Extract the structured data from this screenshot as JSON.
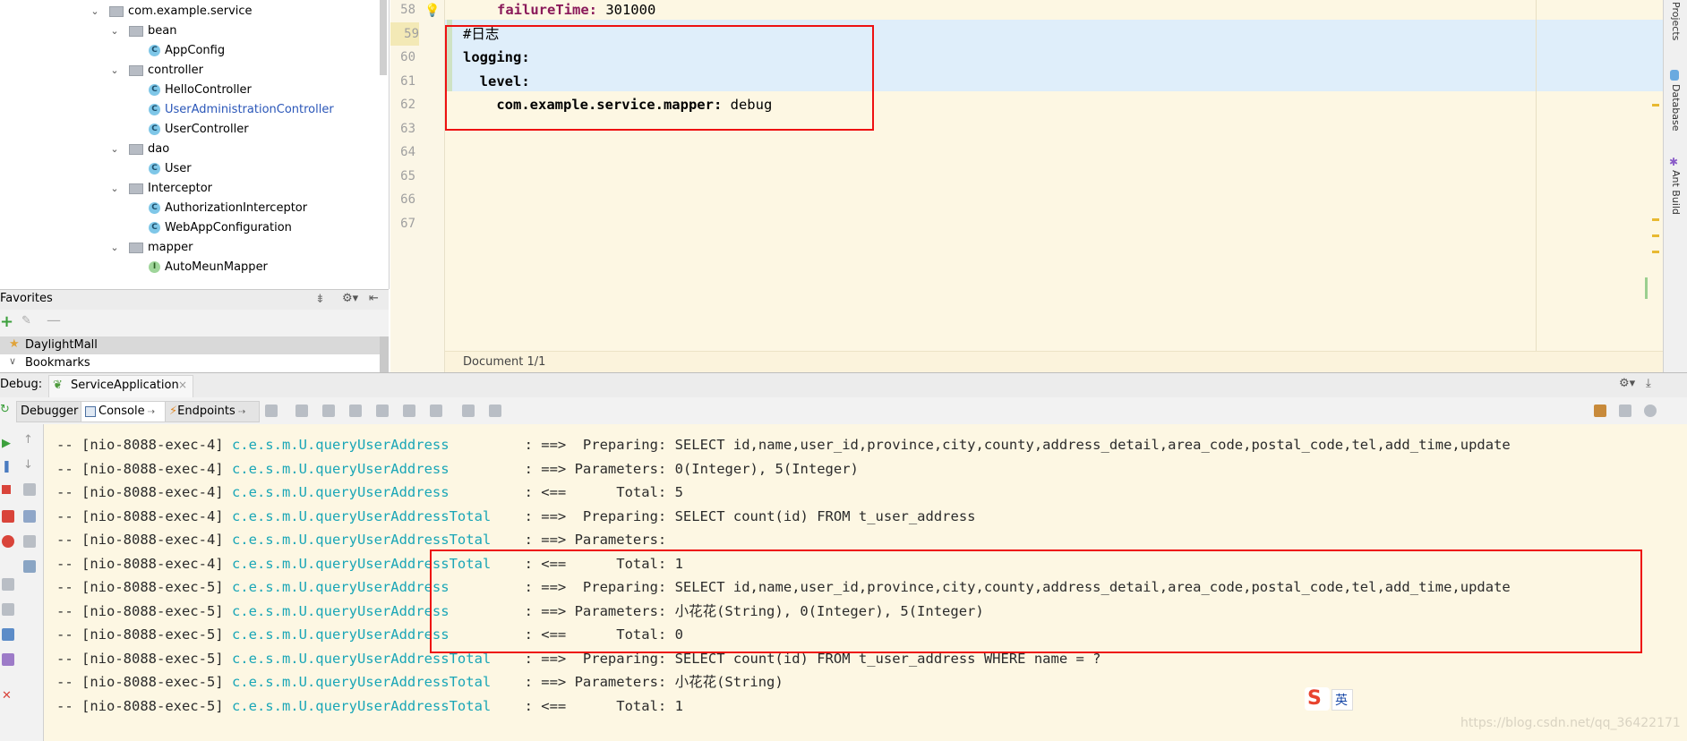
{
  "project_tree": {
    "items": [
      {
        "label": "com.example.service",
        "kind": "package",
        "expanded": true,
        "depth": 0
      },
      {
        "label": "bean",
        "kind": "package",
        "expanded": true,
        "depth": 1
      },
      {
        "label": "AppConfig",
        "kind": "class",
        "depth": 2
      },
      {
        "label": "controller",
        "kind": "package",
        "expanded": true,
        "depth": 1
      },
      {
        "label": "HelloController",
        "kind": "class",
        "depth": 2
      },
      {
        "label": "UserAdministrationController",
        "kind": "class",
        "depth": 2,
        "highlight": true
      },
      {
        "label": "UserController",
        "kind": "class",
        "depth": 2
      },
      {
        "label": "dao",
        "kind": "package",
        "expanded": true,
        "depth": 1
      },
      {
        "label": "User",
        "kind": "class",
        "depth": 2
      },
      {
        "label": "Interceptor",
        "kind": "package",
        "expanded": true,
        "depth": 1
      },
      {
        "label": "AuthorizationInterceptor",
        "kind": "class",
        "depth": 2
      },
      {
        "label": "WebAppConfiguration",
        "kind": "class",
        "depth": 2
      },
      {
        "label": "mapper",
        "kind": "package",
        "expanded": true,
        "depth": 1
      },
      {
        "label": "AutoMeunMapper",
        "kind": "interface",
        "depth": 2
      }
    ]
  },
  "favorites": {
    "title": "Favorites",
    "items": [
      {
        "label": "DaylightMall",
        "icon": "star-icon"
      },
      {
        "label": "Bookmarks",
        "icon": "chevron-down-icon"
      }
    ]
  },
  "editor": {
    "lines": [
      {
        "num": "58",
        "parts": [
          {
            "t": "failureTime:",
            "c": "k2"
          },
          {
            "t": " 301000",
            "c": "v"
          }
        ]
      },
      {
        "num": "59",
        "parts": [
          {
            "t": "#日志",
            "c": "v"
          }
        ]
      },
      {
        "num": "60",
        "parts": [
          {
            "t": "logging:",
            "c": "k"
          }
        ]
      },
      {
        "num": "61",
        "parts": [
          {
            "t": "  level:",
            "c": "k"
          }
        ]
      },
      {
        "num": "62",
        "parts": [
          {
            "t": "    com.example.service.mapper:",
            "c": "k"
          },
          {
            "t": " debug",
            "c": "v"
          }
        ]
      },
      {
        "num": "63",
        "parts": []
      },
      {
        "num": "64",
        "parts": []
      },
      {
        "num": "65",
        "parts": []
      },
      {
        "num": "66",
        "parts": []
      },
      {
        "num": "67",
        "parts": []
      }
    ],
    "status": "Document 1/1"
  },
  "right_strip": {
    "items": [
      "Projects",
      "Database",
      "Ant Build"
    ]
  },
  "debug": {
    "label": "Debug:",
    "session": "ServiceApplication",
    "tabs": [
      "Debugger",
      "Console",
      "Endpoints"
    ]
  },
  "console": {
    "lines": [
      {
        "thread": "-- [nio-8088-exec-4]",
        "logger": "c.e.s.m.U.queryUserAddress",
        "msg": "         : ==>  Preparing: SELECT id,name,user_id,province,city,county,address_detail,area_code,postal_code,tel,add_time,update"
      },
      {
        "thread": "-- [nio-8088-exec-4]",
        "logger": "c.e.s.m.U.queryUserAddress",
        "msg": "         : ==> Parameters: 0(Integer), 5(Integer)"
      },
      {
        "thread": "-- [nio-8088-exec-4]",
        "logger": "c.e.s.m.U.queryUserAddress",
        "msg": "         : <==      Total: 5"
      },
      {
        "thread": "-- [nio-8088-exec-4]",
        "logger": "c.e.s.m.U.queryUserAddressTotal",
        "msg": "    : ==>  Preparing: SELECT count(id) FROM t_user_address"
      },
      {
        "thread": "-- [nio-8088-exec-4]",
        "logger": "c.e.s.m.U.queryUserAddressTotal",
        "msg": "    : ==> Parameters: "
      },
      {
        "thread": "-- [nio-8088-exec-4]",
        "logger": "c.e.s.m.U.queryUserAddressTotal",
        "msg": "    : <==      Total: 1"
      },
      {
        "thread": "-- [nio-8088-exec-5]",
        "logger": "c.e.s.m.U.queryUserAddress",
        "msg": "         : ==>  Preparing: SELECT id,name,user_id,province,city,county,address_detail,area_code,postal_code,tel,add_time,update"
      },
      {
        "thread": "-- [nio-8088-exec-5]",
        "logger": "c.e.s.m.U.queryUserAddress",
        "msg": "         : ==> Parameters: 小花花(String), 0(Integer), 5(Integer)"
      },
      {
        "thread": "-- [nio-8088-exec-5]",
        "logger": "c.e.s.m.U.queryUserAddress",
        "msg": "         : <==      Total: 0"
      },
      {
        "thread": "-- [nio-8088-exec-5]",
        "logger": "c.e.s.m.U.queryUserAddressTotal",
        "msg": "    : ==>  Preparing: SELECT count(id) FROM t_user_address WHERE name = ?"
      },
      {
        "thread": "-- [nio-8088-exec-5]",
        "logger": "c.e.s.m.U.queryUserAddressTotal",
        "msg": "    : ==> Parameters: 小花花(String)"
      },
      {
        "thread": "-- [nio-8088-exec-5]",
        "logger": "c.e.s.m.U.queryUserAddressTotal",
        "msg": "    : <==      Total: 1"
      }
    ]
  },
  "ime_badge": {
    "label": "英"
  },
  "watermark": "https://blog.csdn.net/qq_36422171"
}
